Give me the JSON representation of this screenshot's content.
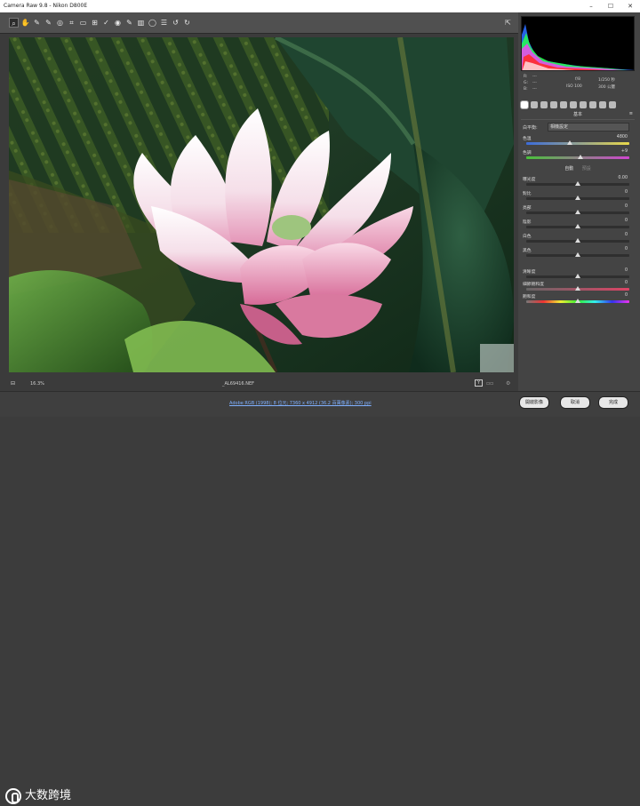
{
  "window": {
    "title": "Camera Raw 9.8 - Nikon D800E",
    "controls": [
      "–",
      "☐",
      "✕"
    ]
  },
  "toolbar": {
    "tools": [
      {
        "name": "zoom-icon",
        "glyph": "⌕",
        "active": true
      },
      {
        "name": "hand-icon",
        "glyph": "✋"
      },
      {
        "name": "white-balance-icon",
        "glyph": "✎"
      },
      {
        "name": "color-sampler-icon",
        "glyph": "✎"
      },
      {
        "name": "target-adjust-icon",
        "glyph": "◎"
      },
      {
        "name": "crop-icon",
        "glyph": "⌗"
      },
      {
        "name": "straighten-icon",
        "glyph": "▭"
      },
      {
        "name": "transform-icon",
        "glyph": "⊞"
      },
      {
        "name": "spot-removal-icon",
        "glyph": "✓"
      },
      {
        "name": "red-eye-icon",
        "glyph": "◉"
      },
      {
        "name": "adjustment-brush-icon",
        "glyph": "✎"
      },
      {
        "name": "graduated-filter-icon",
        "glyph": "▥"
      },
      {
        "name": "radial-filter-icon",
        "glyph": "◯"
      },
      {
        "name": "preferences-icon",
        "glyph": "☰"
      },
      {
        "name": "rotate-left-icon",
        "glyph": "↺"
      },
      {
        "name": "rotate-right-icon",
        "glyph": "↻"
      }
    ],
    "right_icon": "⇱"
  },
  "status": {
    "zoom": "16.3%",
    "filename": "_AL69416.NEF"
  },
  "footer": {
    "workflow_link": "Adobe RGB (1998); 8 位元; 7360 x 4912 (36.2 百萬像素); 300 ppi",
    "logo_text": "大数跨境",
    "buttons": {
      "open": "開啟影像",
      "cancel": "取消",
      "done": "完成"
    }
  },
  "panel": {
    "histogram_colors": {
      "red": "#ff2b2b",
      "green": "#27ff4c",
      "blue": "#2a6bff",
      "cyan": "#36f0ff",
      "magenta": "#ff3bff",
      "white": "#ffffff"
    },
    "meta": {
      "r": "R:",
      "g": "G:",
      "b": "B:",
      "r_val": "---",
      "g_val": "---",
      "b_val": "---",
      "aperture": "f/8",
      "shutter": "1/250 秒",
      "iso": "ISO 100",
      "focal": "300 公釐"
    },
    "section_title": "基本",
    "white_balance": {
      "label": "白平衡:",
      "value": "相機設定"
    },
    "temp": {
      "label": "色溫",
      "value": "4800",
      "pos": 0.42
    },
    "tint": {
      "label": "色調",
      "value": "+9",
      "pos": 0.53
    },
    "auto": "自動",
    "default": "預設",
    "sliders": [
      {
        "label": "曝光度",
        "value": "0.00",
        "pos": 0.5
      },
      {
        "label": "對比",
        "value": "0",
        "pos": 0.5
      },
      {
        "label": "亮部",
        "value": "0",
        "pos": 0.5
      },
      {
        "label": "陰影",
        "value": "0",
        "pos": 0.5
      },
      {
        "label": "白色",
        "value": "0",
        "pos": 0.5
      },
      {
        "label": "黑色",
        "value": "0",
        "pos": 0.5
      }
    ],
    "sliders2": [
      {
        "label": "清晰度",
        "value": "0",
        "pos": 0.5
      },
      {
        "label": "細節飽和度",
        "value": "0",
        "pos": 0.5
      },
      {
        "label": "飽和度",
        "value": "0",
        "pos": 0.5
      }
    ]
  }
}
